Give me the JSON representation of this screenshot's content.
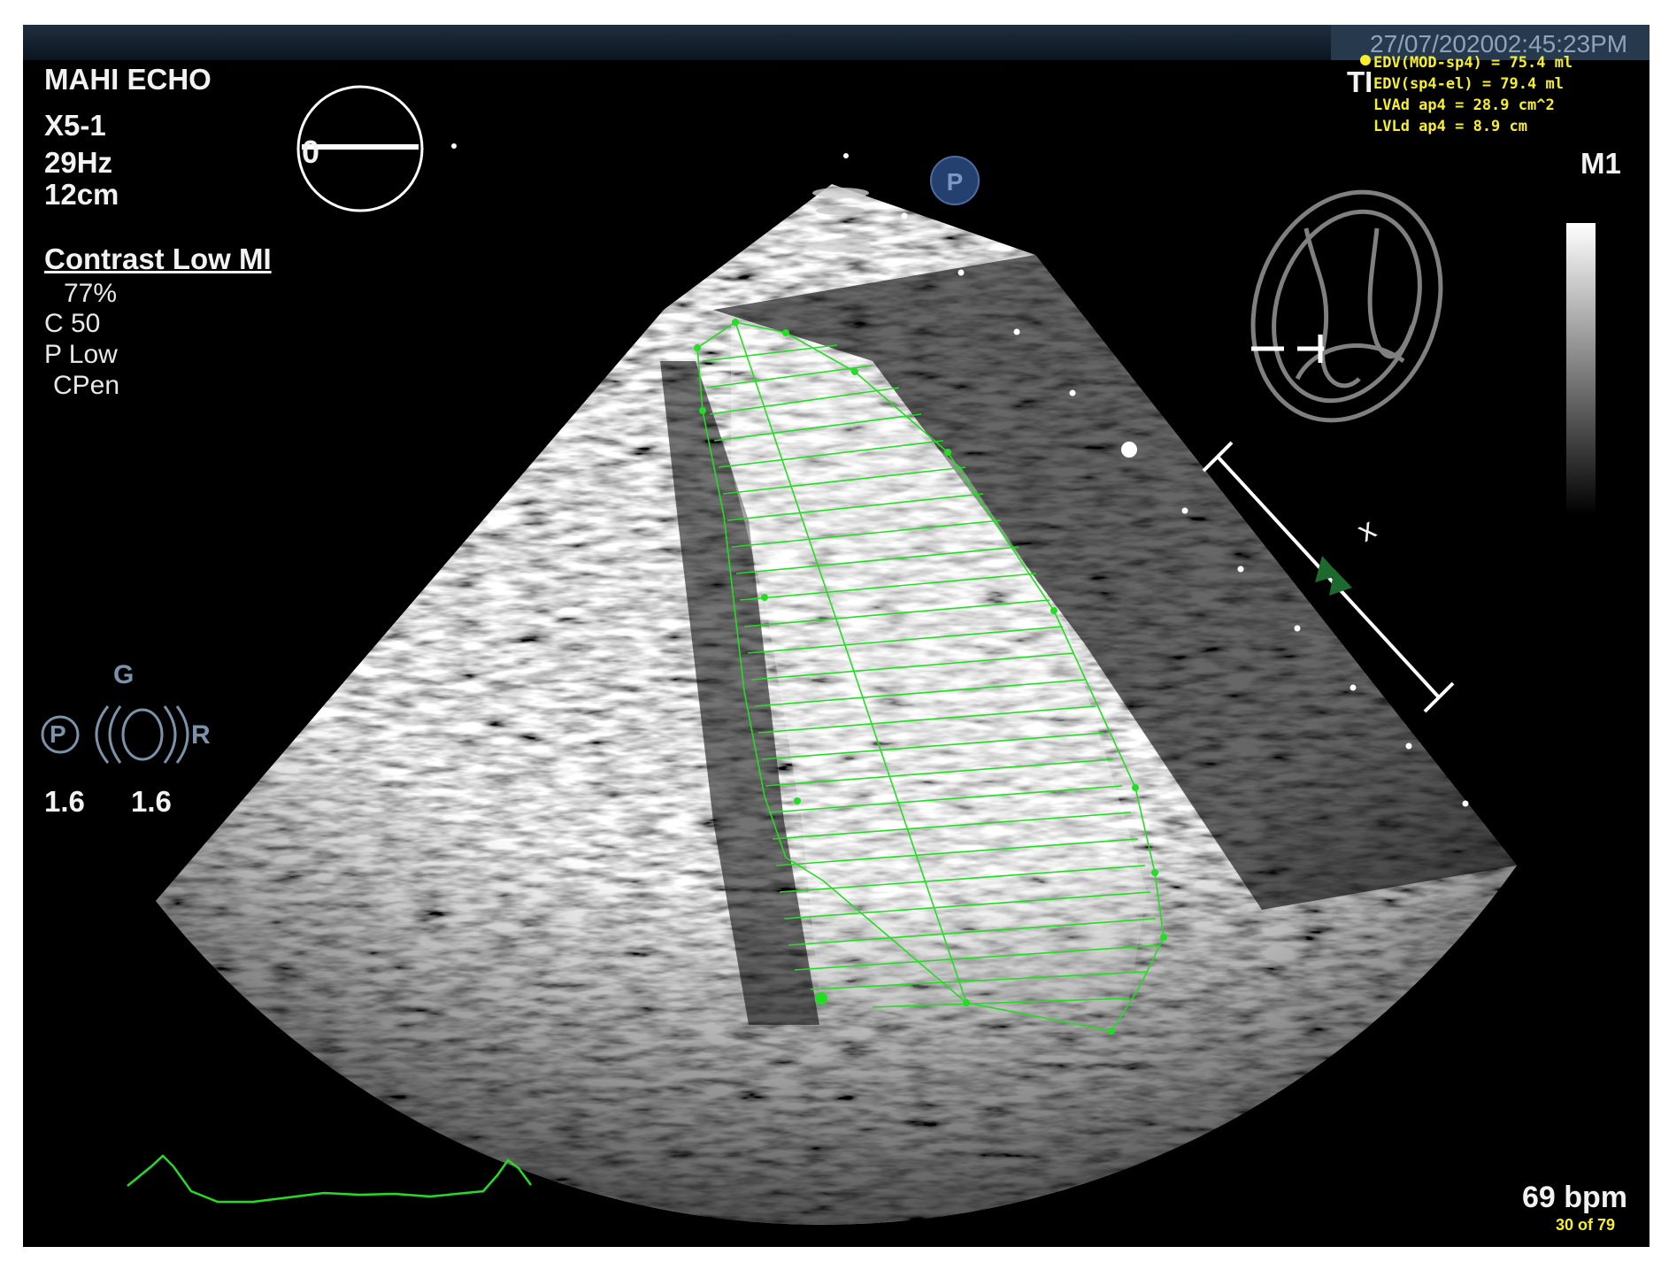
{
  "header": {
    "datetime": "27/07/202002:45:23PM",
    "institution": "MAHI ECHO",
    "probe": "X5-1",
    "frame_rate": "29Hz",
    "depth": "12cm",
    "angle": "0",
    "ti_label": "TI",
    "map": "M1"
  },
  "mode": {
    "title": "Contrast Low MI",
    "params": [
      "77%",
      "C 50",
      "P Low",
      "CPen"
    ]
  },
  "measurements": [
    "EDV(MOD-sp4) = 75.4 ml",
    "EDV(sp4-el) = 79.4 ml",
    "LVAd ap4 = 28.9 cm^2",
    "LVLd ap4 = 8.9 cm"
  ],
  "controls": {
    "gain_label": "G",
    "res_label": "R",
    "p_label": "P",
    "gain_value": "1.6",
    "res_value": "1.6",
    "focus_label": "x"
  },
  "footer": {
    "heart_rate": "69 bpm",
    "frame": "30 of 79"
  },
  "colors": {
    "trace": "#22dd22",
    "measurement_text": "#f6ef2a",
    "probe_icon": "#7b93aa"
  },
  "icons": [
    "orientation-circle-icon",
    "probe-p-icon",
    "heart-apical-icon",
    "greyscale-bar",
    "pulse-probe-icon",
    "ecg-trace"
  ]
}
